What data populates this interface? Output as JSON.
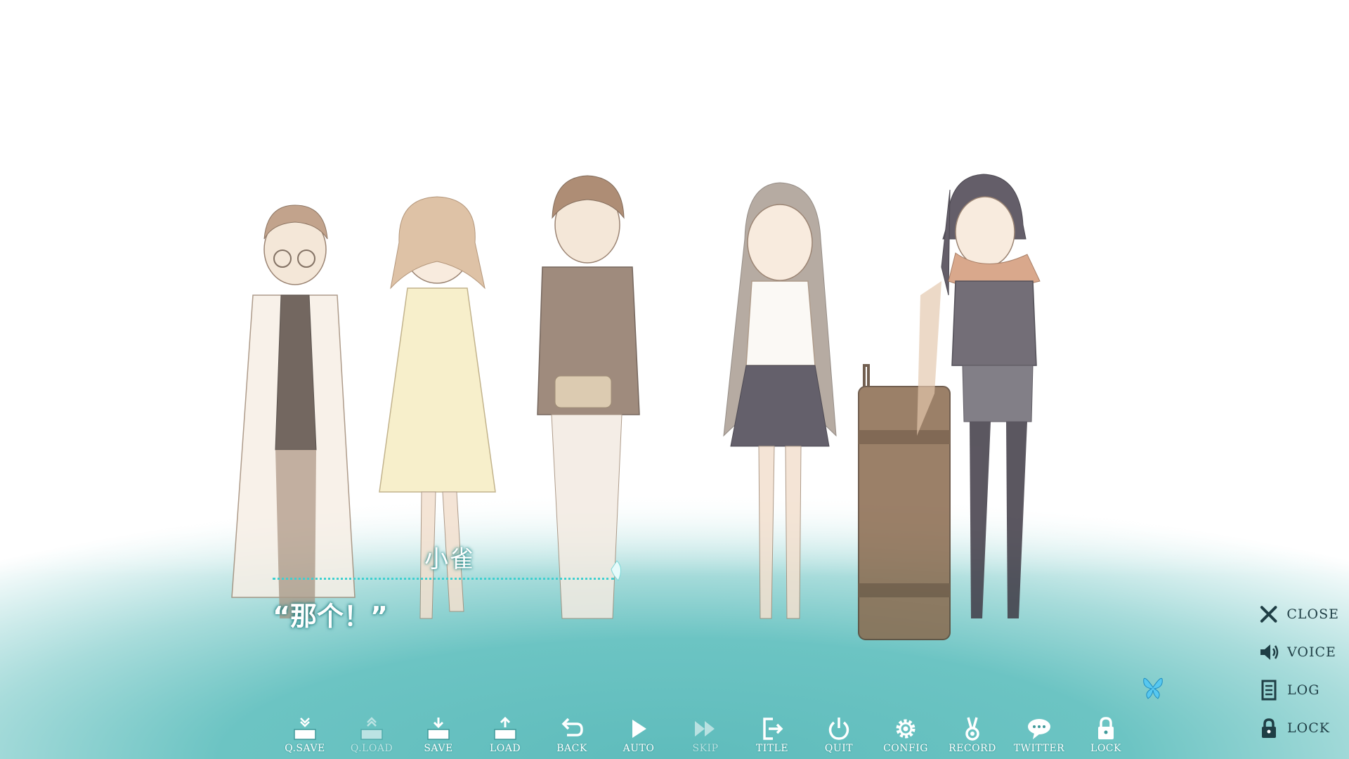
{
  "scene": {
    "speaker": "小雀",
    "dialogue": "“那个！”",
    "characters": [
      "boy-glasses-labcoat",
      "girl-yellow-dress",
      "boy-hoodie",
      "girl-long-hair",
      "girl-scarf-suitcase"
    ]
  },
  "side_menu": [
    {
      "label": "CLOSE",
      "icon": "close-icon"
    },
    {
      "label": "VOICE",
      "icon": "voice-icon"
    },
    {
      "label": "LOG",
      "icon": "log-icon"
    },
    {
      "label": "LOCK",
      "icon": "lock-icon"
    }
  ],
  "toolbar": [
    {
      "label": "Q.SAVE",
      "icon": "quick-save-icon",
      "enabled": true
    },
    {
      "label": "Q.LOAD",
      "icon": "quick-load-icon",
      "enabled": false
    },
    {
      "label": "SAVE",
      "icon": "save-icon",
      "enabled": true
    },
    {
      "label": "LOAD",
      "icon": "load-icon",
      "enabled": true
    },
    {
      "label": "BACK",
      "icon": "back-icon",
      "enabled": true
    },
    {
      "label": "AUTO",
      "icon": "auto-play-icon",
      "enabled": true
    },
    {
      "label": "SKIP",
      "icon": "skip-icon",
      "enabled": false
    },
    {
      "label": "TITLE",
      "icon": "title-icon",
      "enabled": true
    },
    {
      "label": "QUIT",
      "icon": "power-icon",
      "enabled": true
    },
    {
      "label": "CONFIG",
      "icon": "gear-icon",
      "enabled": true
    },
    {
      "label": "RECORD",
      "icon": "medal-icon",
      "enabled": true
    },
    {
      "label": "TWITTER",
      "icon": "speech-bubble-icon",
      "enabled": true
    },
    {
      "label": "LOCK",
      "icon": "lock-icon",
      "enabled": true
    }
  ],
  "colors": {
    "accent": "#5fbcbc",
    "ui_dark": "#1f3e45",
    "text_glow": "#2a8e8e"
  }
}
